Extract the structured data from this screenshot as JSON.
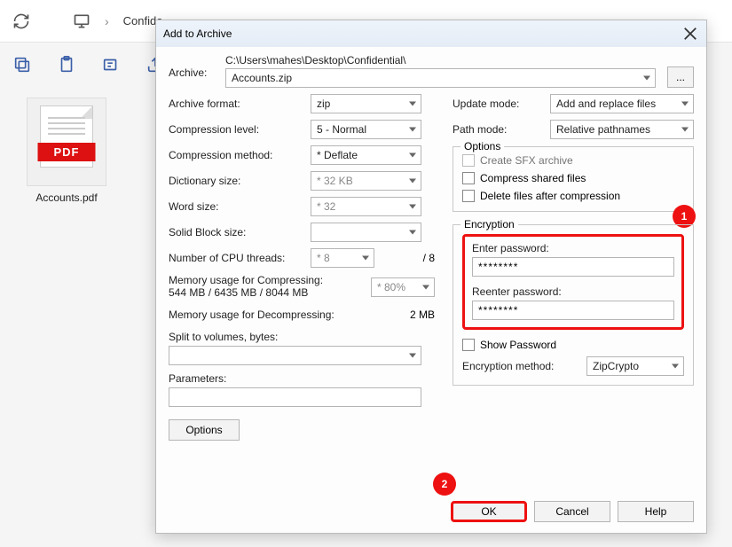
{
  "browser": {
    "tab_title": "Confide"
  },
  "desktop": {
    "pdf_badge": "PDF",
    "pdf_filename": "Accounts.pdf"
  },
  "dialog": {
    "title": "Add to Archive",
    "archive_label": "Archive:",
    "archive_path": "C:\\Users\\mahes\\Desktop\\Confidential\\",
    "archive_name": "Accounts.zip",
    "browse_btn": "...",
    "left": {
      "archive_format_label": "Archive format:",
      "archive_format_value": "zip",
      "compression_level_label": "Compression level:",
      "compression_level_value": "5 - Normal",
      "compression_method_label": "Compression method:",
      "compression_method_value": "* Deflate",
      "dictionary_size_label": "Dictionary size:",
      "dictionary_size_value": "* 32 KB",
      "word_size_label": "Word size:",
      "word_size_value": "* 32",
      "solid_block_label": "Solid Block size:",
      "solid_block_value": "",
      "cpu_threads_label": "Number of CPU threads:",
      "cpu_threads_value": "* 8",
      "cpu_threads_total": "/ 8",
      "mem_compress_label": "Memory usage for Compressing:",
      "mem_compress_detail": "544 MB / 6435 MB / 8044 MB",
      "mem_compress_value": "* 80%",
      "mem_decompress_label": "Memory usage for Decompressing:",
      "mem_decompress_value": "2 MB",
      "split_label": "Split to volumes, bytes:",
      "split_value": "",
      "parameters_label": "Parameters:",
      "parameters_value": "",
      "options_btn": "Options"
    },
    "right": {
      "update_mode_label": "Update mode:",
      "update_mode_value": "Add and replace files",
      "path_mode_label": "Path mode:",
      "path_mode_value": "Relative pathnames",
      "options_group": "Options",
      "create_sfx": "Create SFX archive",
      "compress_shared": "Compress shared files",
      "delete_after": "Delete files after compression",
      "encryption_group": "Encryption",
      "enter_pwd_label": "Enter password:",
      "enter_pwd_value": "********",
      "reenter_pwd_label": "Reenter password:",
      "reenter_pwd_value": "********",
      "show_pwd": "Show Password",
      "enc_method_label": "Encryption method:",
      "enc_method_value": "ZipCrypto"
    },
    "footer": {
      "ok": "OK",
      "cancel": "Cancel",
      "help": "Help"
    },
    "callout1": "1",
    "callout2": "2"
  }
}
